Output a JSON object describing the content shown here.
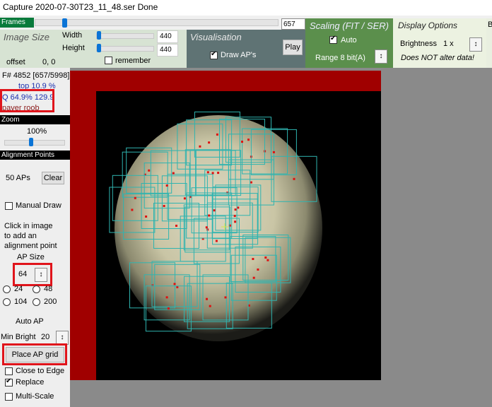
{
  "window": {
    "title": "Capture 2020-07-30T23_11_48.ser   Done"
  },
  "frames": {
    "label": "Frames",
    "position_fraction": 0.12,
    "value": "657"
  },
  "image_size": {
    "title": "Image Size",
    "width_label": "Width",
    "width_value": "440",
    "height_label": "Height",
    "height_value": "440",
    "offset_label": "offset",
    "offset_value": "0,  0",
    "remember_label": "remember",
    "remember_checked": false
  },
  "visualisation": {
    "title": "Visualisation",
    "draw_aps_label": "Draw AP's",
    "draw_aps_checked": true,
    "play_label": "Play"
  },
  "scaling": {
    "title": "Scaling (FIT / SER)",
    "auto_label": "Auto",
    "auto_checked": true,
    "range_label": "Range 8 bit(A)"
  },
  "display_options": {
    "title": "Display Options",
    "brightness_label": "Brightness",
    "brightness_value": "1 x",
    "note": "Does NOT alter data!",
    "extra_label": "B"
  },
  "frame_info": {
    "frame": "F# 4852 [657/5998]",
    "top": "top 10.9 %",
    "quality": "Q 64.9%   129.9",
    "dropper": "paver roob"
  },
  "zoom": {
    "header": "Zoom",
    "value": "100%",
    "position_fraction": 0.5
  },
  "alignment_points": {
    "header": "Alignment Points",
    "count_label": "50 APs",
    "clear_label": "Clear",
    "manual_draw_label": "Manual Draw",
    "manual_draw_checked": false,
    "instructions": [
      "Click in image",
      "to add an",
      "alignment point"
    ],
    "ap_size_label": "AP Size",
    "ap_size_value": "64",
    "radio_options": [
      "24",
      "48",
      "104",
      "200"
    ],
    "auto_ap_label": "Auto AP",
    "min_bright_label": "Min Bright",
    "min_bright_value": "20",
    "place_grid_label": "Place AP grid",
    "close_to_edge_label": "Close to Edge",
    "close_to_edge_checked": false,
    "replace_label": "Replace",
    "replace_checked": true,
    "multi_scale_label": "Multi-Scale",
    "multi_scale_checked": false
  },
  "colors": {
    "accent_blue": "#0a74d6",
    "frames_green": "#087a3b",
    "highlight_red": "#e0141b",
    "ap_box": "#2fb4b0",
    "ap_point": "#e01010"
  },
  "icons": {
    "spin": "spin-arrows-icon"
  }
}
